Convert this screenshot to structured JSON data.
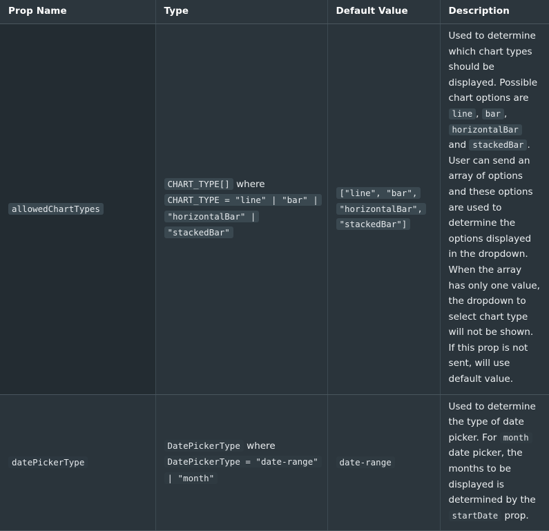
{
  "table": {
    "headers": [
      {
        "label": "Prop Name"
      },
      {
        "label": "Type"
      },
      {
        "label": "Default Value"
      },
      {
        "label": "Description"
      }
    ],
    "rows": [
      {
        "prop_name": "allowedChartTypes",
        "type": {
          "code_1": "CHART_TYPE[]",
          "plain_1": "where",
          "code_2": "CHART_TYPE = \"line\" | \"bar\" | \"horizontalBar\" | \"stackedBar\""
        },
        "default_value": "[\"line\", \"bar\", \"horizontalBar\", \"stackedBar\"]",
        "description": {
          "t1": "Used to determine which chart types should be displayed. Possible chart options are ",
          "c1": "line",
          "t2": ", ",
          "c2": "bar",
          "t3": ", ",
          "c3": "horizontalBar",
          "t4": " and ",
          "c4": "stackedBar",
          "t5": ". User can send an array of options and these options are used to determine the options displayed in the dropdown. When the array has only one value, the dropdown to select chart type will not be shown.",
          "t6": "If this prop is not sent, will use default value."
        }
      },
      {
        "prop_name": "datePickerType",
        "type": {
          "code_1": "DatePickerType",
          "plain_1": "where",
          "code_2": "DatePickerType = \"date-range\" | \"month\""
        },
        "default_value": "date-range",
        "description": {
          "t1": "Used to determine the type of date picker. For ",
          "c1": "month",
          "t2": " date picker, the months to be displayed is determined by the ",
          "c2": "startDate",
          "t3": " prop."
        }
      }
    ]
  },
  "colors": {
    "page_background": "#222b31",
    "header_background": "#2c363d",
    "cell_background": "#2a343b",
    "prop_cell_background": "#232c32",
    "border": "#4a565e",
    "text": "#eceff1",
    "code_chip_background": "#3a4850"
  }
}
